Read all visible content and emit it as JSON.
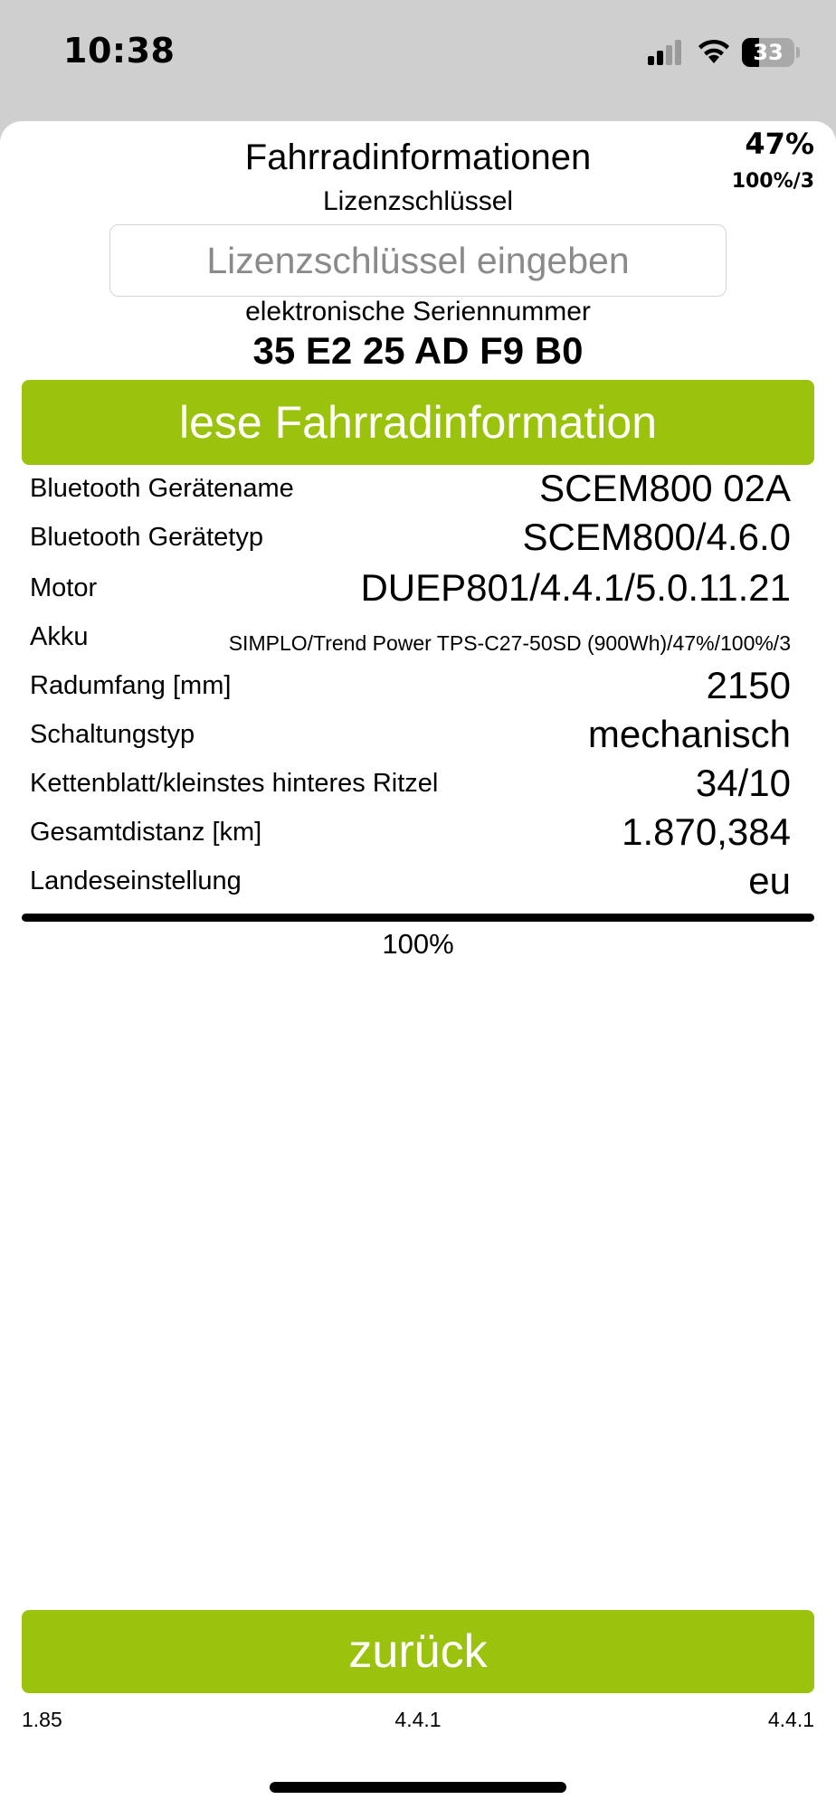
{
  "status_bar": {
    "time": "10:38",
    "battery_level": "33",
    "battery_fraction": 0.33
  },
  "header": {
    "title": "Fahrradinformationen",
    "battery_percent": "47%",
    "battery_sub": "100%/3"
  },
  "license": {
    "label": "Lizenzschlüssel",
    "placeholder": "Lizenzschlüssel eingeben",
    "value": ""
  },
  "serial": {
    "label": "elektronische Seriennummer",
    "value": "35 E2 25 AD F9 B0"
  },
  "read_button_label": "lese Fahrradinformation",
  "info_rows": [
    {
      "label": "Bluetooth Gerätename",
      "value": "SCEM800 02A"
    },
    {
      "label": "Bluetooth Gerätetyp",
      "value": "SCEM800/4.6.0"
    },
    {
      "label": "Motor",
      "value": "DUEP801/4.4.1/5.0.11.21"
    },
    {
      "label": "Akku",
      "value": "SIMPLO/Trend Power TPS-C27-50SD (900Wh)/47%/100%/3"
    },
    {
      "label": "Radumfang [mm]",
      "value": "2150"
    },
    {
      "label": "Schaltungstyp",
      "value": "mechanisch"
    },
    {
      "label": "Kettenblatt/kleinstes hinteres Ritzel",
      "value": "34/10"
    },
    {
      "label": "Gesamtdistanz [km]",
      "value": "1.870,384"
    },
    {
      "label": "Landeseinstellung",
      "value": "eu"
    }
  ],
  "progress": {
    "label": "100%",
    "fraction": 1.0
  },
  "back_button_label": "zurück",
  "footer_versions": {
    "left": "1.85",
    "center": "4.4.1",
    "right": "4.4.1"
  },
  "colors": {
    "accent_green": "#9bc30e",
    "status_bar_bg": "#cfcfcf",
    "sheet_bg": "#ffffff"
  }
}
